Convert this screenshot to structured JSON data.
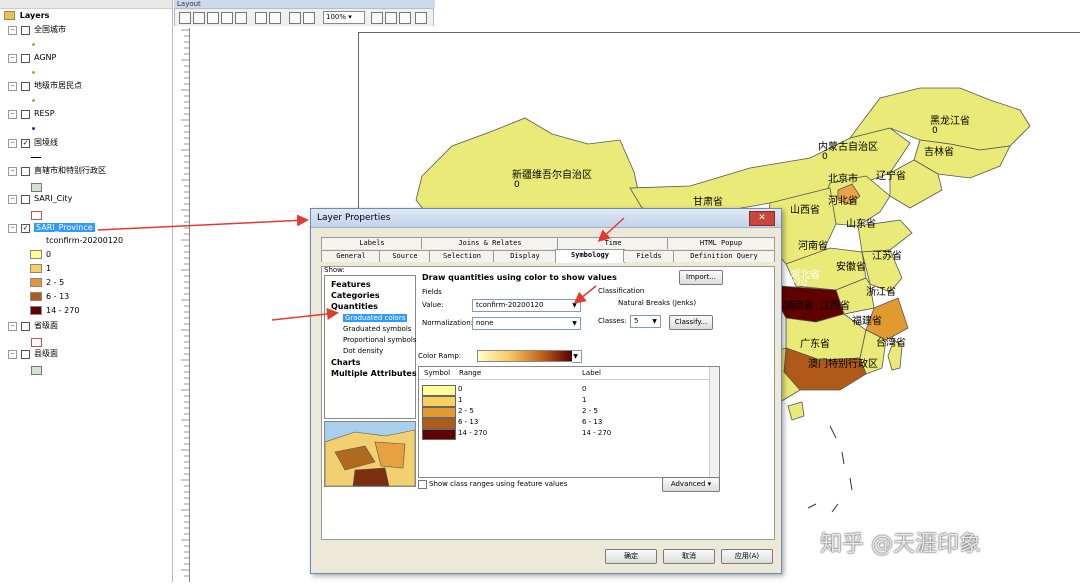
{
  "toc": {
    "root_label": "Layers",
    "layers": [
      {
        "name": "全国城市",
        "checked": false,
        "symbol": "dot",
        "color": "#c8a040"
      },
      {
        "name": "AGNP",
        "checked": false,
        "symbol": "dot",
        "color": "#c8a040"
      },
      {
        "name": "地级市居民点",
        "checked": false,
        "symbol": "dot",
        "color": "#c8a040"
      },
      {
        "name": "RESP",
        "checked": false,
        "symbol": "dot",
        "color": "#2a2aa0"
      },
      {
        "name": "国境线",
        "checked": true,
        "symbol": "line",
        "color": "#000000"
      },
      {
        "name": "直辖市和特别行政区",
        "checked": false,
        "symbol": "box",
        "color": "#cce5cc"
      },
      {
        "name": "SARI_City",
        "checked": false,
        "symbol": "box",
        "color": "#ffffff"
      },
      {
        "name": "SARI_Province",
        "checked": true,
        "selected": true,
        "field": "tconfirm-20200120"
      },
      {
        "name": "省级面",
        "checked": false,
        "symbol": "box",
        "color": "#ffffff"
      },
      {
        "name": "县级面",
        "checked": false,
        "symbol": "box",
        "color": "#cce5cc"
      }
    ],
    "classes": [
      {
        "label": "0",
        "color": "#ffff96"
      },
      {
        "label": "1",
        "color": "#f7d060"
      },
      {
        "label": "2 - 5",
        "color": "#e09a30"
      },
      {
        "label": "6 - 13",
        "color": "#b05a1a"
      },
      {
        "label": "14 - 270",
        "color": "#600000"
      }
    ]
  },
  "layout_window": {
    "title": "Layout",
    "zoom": "100%"
  },
  "map": {
    "labels": [
      {
        "name": "黑龙江省",
        "value": "0"
      },
      {
        "name": "吉林省",
        "value": ""
      },
      {
        "name": "内蒙古自治区",
        "value": "0"
      },
      {
        "name": "辽宁省",
        "value": ""
      },
      {
        "name": "新疆维吾尔自治区",
        "value": "0"
      },
      {
        "name": "北京市",
        "value": ""
      },
      {
        "name": "甘肃省",
        "value": ""
      },
      {
        "name": "河北省",
        "value": ""
      },
      {
        "name": "山西省",
        "value": ""
      },
      {
        "name": "山东省",
        "value": ""
      },
      {
        "name": "河南省",
        "value": ""
      },
      {
        "name": "江苏省",
        "value": ""
      },
      {
        "name": "安徽省",
        "value": ""
      },
      {
        "name": "湖北省",
        "value": "270"
      },
      {
        "name": "浙江省",
        "value": ""
      },
      {
        "name": "湖南省",
        "value": ""
      },
      {
        "name": "江西省",
        "value": ""
      },
      {
        "name": "福建省",
        "value": ""
      },
      {
        "name": "台湾省",
        "value": ""
      },
      {
        "name": "广东省",
        "value": ""
      },
      {
        "name": "澳门特别行政区",
        "value": ""
      }
    ],
    "watermark": "知乎 @天涯印象"
  },
  "dialog": {
    "title": "Layer Properties",
    "tabs_top": [
      "Labels",
      "Joins & Relates",
      "Time",
      "HTML Popup"
    ],
    "tabs_bottom": [
      "General",
      "Source",
      "Selection",
      "Display",
      "Symbology",
      "Fields",
      "Definition Query"
    ],
    "active_tab": "Symbology",
    "show_label": "Show:",
    "show_items": [
      {
        "label": "Features",
        "level": 0
      },
      {
        "label": "Categories",
        "level": 0
      },
      {
        "label": "Quantities",
        "level": 0
      },
      {
        "label": "Graduated colors",
        "level": 1,
        "selected": true
      },
      {
        "label": "Graduated symbols",
        "level": 1
      },
      {
        "label": "Proportional symbols",
        "level": 1
      },
      {
        "label": "Dot density",
        "level": 1
      },
      {
        "label": "Charts",
        "level": 0
      },
      {
        "label": "Multiple Attributes",
        "level": 0
      }
    ],
    "heading": "Draw quantities using color to show values",
    "import_button": "Import...",
    "fields_group": "Fields",
    "value_label": "Value:",
    "value_field": "tconfirm-20200120",
    "normalization_label": "Normalization:",
    "normalization_value": "none",
    "classification_group": "Classification",
    "classification_method": "Natural Breaks (Jenks)",
    "classes_label": "Classes:",
    "classes_value": "5",
    "classify_button": "Classify...",
    "color_ramp_label": "Color Ramp:",
    "table_headers": [
      "Symbol",
      "Range",
      "Label"
    ],
    "rows": [
      {
        "range": "0",
        "label": "0",
        "color": "#ffff96"
      },
      {
        "range": "1",
        "label": "1",
        "color": "#f7d060"
      },
      {
        "range": "2 - 5",
        "label": "2 - 5",
        "color": "#e09a30"
      },
      {
        "range": "6 - 13",
        "label": "6 - 13",
        "color": "#b05a1a"
      },
      {
        "range": "14 - 270",
        "label": "14 - 270",
        "color": "#600000"
      }
    ],
    "show_class_ranges": "Show class ranges using feature values",
    "advanced_button": "Advanced",
    "ok_button": "确定",
    "cancel_button": "取消",
    "apply_button": "应用(A)"
  },
  "colors": {
    "highlight": "#3399ff",
    "arrow": "#e03b30",
    "map_base": "#eaea78"
  }
}
